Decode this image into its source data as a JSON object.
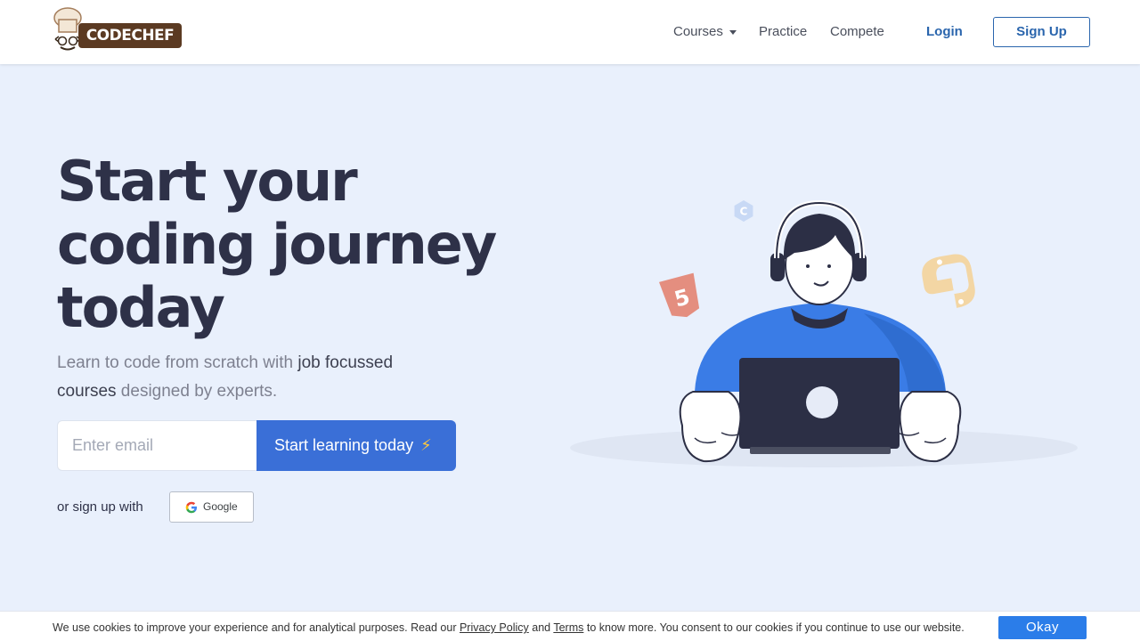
{
  "header": {
    "logo_text": "CODECHEF",
    "nav": {
      "courses": "Courses",
      "practice": "Practice",
      "compete": "Compete"
    },
    "login": "Login",
    "signup": "Sign Up"
  },
  "hero": {
    "title_line1": "Start your",
    "title_line2": "coding journey",
    "title_line3": "today",
    "sub_part1": "Learn to code from scratch with ",
    "sub_highlight1": "job focussed courses",
    "sub_part2": " designed by experts.",
    "email_placeholder": "Enter email",
    "cta_label": "Start learning today",
    "cta_icon": "lightning-bolt-icon",
    "or_text": "or sign up with",
    "google_label": "Google"
  },
  "cookie": {
    "text_1": "We use cookies to improve your experience and for analytical purposes. Read our ",
    "privacy_link": "Privacy Policy",
    "text_2": " and ",
    "terms_link": "Terms",
    "text_3": " to know more. You consent to our cookies if you continue to use our website.",
    "okay": "Okay"
  },
  "colors": {
    "page_bg": "#e9f0fc",
    "brand_blue": "#3a6fd7",
    "link_blue": "#2a65ad",
    "cookie_button": "#2b7de9",
    "title_text": "#2e3148"
  }
}
